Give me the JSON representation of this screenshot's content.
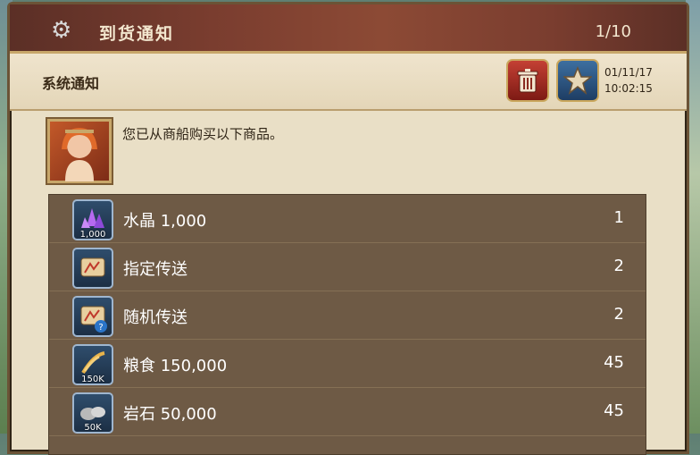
{
  "header": {
    "title": "到货通知",
    "count": "1/10"
  },
  "sub": {
    "title": "系统通知",
    "date": "01/11/17",
    "time": "10:02:15"
  },
  "message": {
    "text": "您已从商船购买以下商品。"
  },
  "items": [
    {
      "name": "水晶 1,000",
      "qty": "1",
      "tag": "1,000"
    },
    {
      "name": "指定传送",
      "qty": "2",
      "tag": ""
    },
    {
      "name": "随机传送",
      "qty": "2",
      "tag": ""
    },
    {
      "name": "粮食 150,000",
      "qty": "45",
      "tag": "150K"
    },
    {
      "name": "岩石 50,000",
      "qty": "45",
      "tag": "50K"
    }
  ]
}
